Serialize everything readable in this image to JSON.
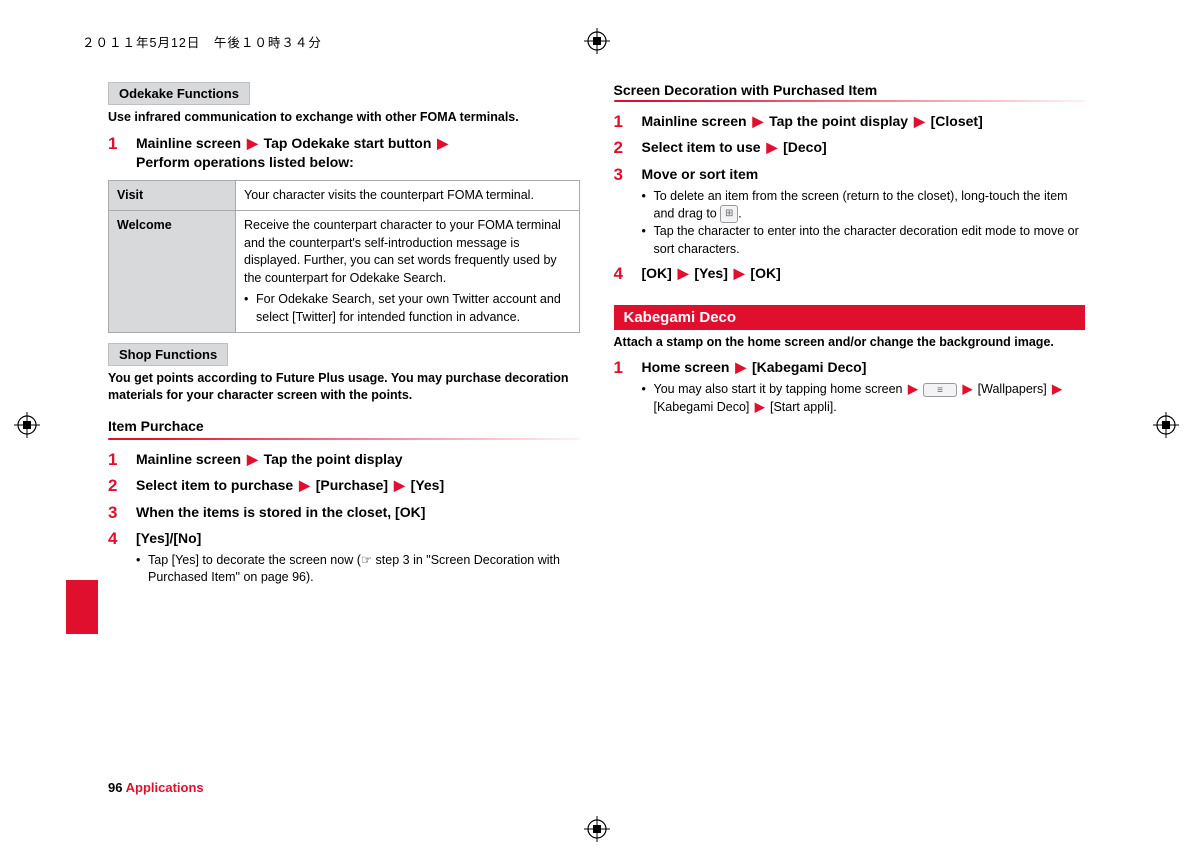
{
  "timestamp": "２０１１年5月12日　午後１０時３４分",
  "left": {
    "odekake": {
      "title": "Odekake Functions",
      "intro": "Use infrared communication to exchange with other FOMA terminals.",
      "step1_a": "Mainline screen",
      "step1_b": "Tap Odekake start button",
      "step1_c": "Perform operations listed below:",
      "table": {
        "visit_h": "Visit",
        "visit_d": "Your character visits the counterpart FOMA terminal.",
        "welcome_h": "Welcome",
        "welcome_d": "Receive the counterpart character to your FOMA terminal and the counterpart's self-introduction message is displayed. Further, you can set words frequently used by the counterpart for Odekake Search.",
        "welcome_b": "For Odekake Search, set your own Twitter account and select [Twitter] for intended function in advance."
      }
    },
    "shop": {
      "title": "Shop Functions",
      "intro": "You get points according to Future Plus usage. You may purchase decoration materials for your character screen with the points.",
      "section": "Item Purchace",
      "s1_a": "Mainline screen",
      "s1_b": "Tap the point display",
      "s2_a": "Select item to purchase",
      "s2_b": "[Purchase]",
      "s2_c": "[Yes]",
      "s3": "When the items is stored in the closet, [OK]",
      "s4": "[Yes]/[No]",
      "s4_note": "Tap [Yes] to decorate the screen now (☞ step 3 in \"Screen Decoration with Purchased Item\" on page 96)."
    }
  },
  "right": {
    "deco": {
      "title": "Screen Decoration with Purchased Item",
      "s1_a": "Mainline screen",
      "s1_b": "Tap the point display",
      "s1_c": "[Closet]",
      "s2_a": "Select item to use",
      "s2_b": "[Deco]",
      "s3": "Move or sort item",
      "s3_b1a": "To delete an item from the screen (return to the closet), long-touch the item and drag to ",
      "s3_b1b": ".",
      "s3_b2": "Tap the character to enter into the character decoration edit mode to move or sort characters.",
      "s4_a": "[OK]",
      "s4_b": "[Yes]",
      "s4_c": "[OK]"
    },
    "kabe": {
      "title": "Kabegami Deco",
      "intro": "Attach a stamp on the home screen and/or change the background image.",
      "s1_a": "Home screen",
      "s1_b": "[Kabegami Deco]",
      "s1_n1": "You may also start it by tapping home screen",
      "s1_n2": "[Wallpapers]",
      "s1_n3": "[Kabegami Deco]",
      "s1_n4": "[Start appli]."
    }
  },
  "footer": {
    "page": "96",
    "category": "Applications"
  }
}
